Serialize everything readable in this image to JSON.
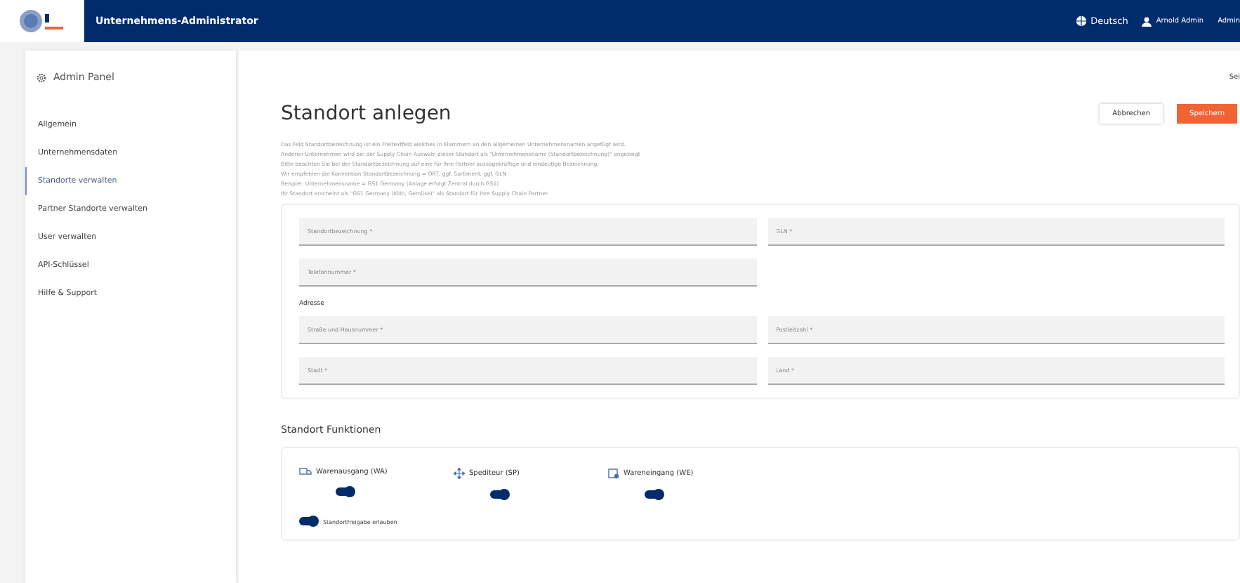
{
  "header": {
    "title": "Unternehmens-Administrator",
    "language": "Deutsch",
    "user": "Arnold Admin",
    "role": "Admin"
  },
  "sidebar": {
    "title": "Admin Panel",
    "items": [
      {
        "label": "Allgemein",
        "selected": false
      },
      {
        "label": "Unternehmensdaten",
        "selected": false
      },
      {
        "label": "Standorte verwalten",
        "selected": true
      },
      {
        "label": "Partner Standorte verwalten",
        "selected": false
      },
      {
        "label": "User verwalten",
        "selected": false
      },
      {
        "label": "API-Schlüssel",
        "selected": false
      },
      {
        "label": "Hilfe & Support",
        "selected": false
      }
    ]
  },
  "corner_text": "Sei",
  "page": {
    "title": "Standort anlegen",
    "buttons": [
      {
        "label": "Abbrechen",
        "kind": "secondary"
      },
      {
        "label": "Speichern",
        "kind": "primary"
      }
    ],
    "description": [
      "Das Feld Standortbezeichnung ist ein Freitextfeld welches in Klammern an den allgemeinen Unternehmensnamen angefügt wird.",
      "Anderen Unternehmen wird bei der Supply Chain Auswahl dieser Standort als \"Unternehmensname (Standortbezeichnung)\" angezeigt",
      "Bitte beachten Sie bei der Standortbezeichnung auf eine für Ihre Partner aussagekräftige und eindeutige Bezeichnung.",
      "Wir empfehlen die Konvention Standortbezeichnung = ORT, ggf. Sortiment, ggf. GLN",
      "Beispiel: Unternehmensname = GS1 Germany (Anlage erfolgt Zentral durch GS1)",
      "Ihr Standort erscheint als \"GS1 Germany (Köln, Gemüse)\" als Standort für Ihre Supply Chain Partner."
    ]
  },
  "form": {
    "fields": [
      {
        "placeholder": "Standortbezeichnung *"
      },
      {
        "placeholder": "GLN *"
      },
      {
        "placeholder": "Telefonnummer *"
      }
    ],
    "address_label": "Adresse",
    "address_fields": [
      {
        "placeholder": "Straße und Hausnummer *"
      },
      {
        "placeholder": "Postleitzahl *"
      },
      {
        "placeholder": "Stadt *"
      },
      {
        "placeholder": "Land *"
      }
    ]
  },
  "functions": {
    "title": "Standort Funktionen",
    "items": [
      {
        "label": "Warenausgang (WA)",
        "kind": "truck",
        "on": true
      },
      {
        "label": "Spediteur (SP)",
        "kind": "move",
        "on": true
      },
      {
        "label": "Wareneingang (WE)",
        "kind": "inbox",
        "on": true
      }
    ],
    "share": {
      "label": "Standortfreigabe erlauben",
      "on": true
    }
  }
}
